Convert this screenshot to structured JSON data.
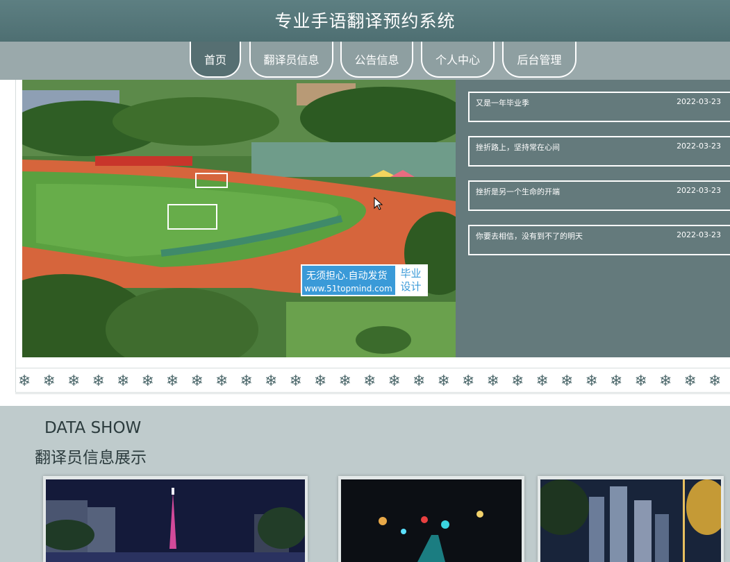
{
  "header": {
    "title": "专业手语翻译预约系统"
  },
  "nav": [
    {
      "label": "首页",
      "active": true
    },
    {
      "label": "翻译员信息"
    },
    {
      "label": "公告信息"
    },
    {
      "label": "个人中心"
    },
    {
      "label": "后台管理"
    }
  ],
  "news": [
    {
      "title": "又是一年毕业季",
      "date": "2022-03-23"
    },
    {
      "title": "挫折路上，坚持常在心间",
      "date": "2022-03-23"
    },
    {
      "title": "挫折是另一个生命的开端",
      "date": "2022-03-23"
    },
    {
      "title": "你要去相信，没有到不了的明天",
      "date": "2022-03-23"
    }
  ],
  "watermark": {
    "line1": "无须担心.自动发货",
    "line2": "www.51topmind.com",
    "right_top": "毕业",
    "right_bottom": "设计"
  },
  "decor": {
    "snowflake_glyph": "❄",
    "snowflake_count": 29
  },
  "data_show": {
    "title_en": "DATA SHOW",
    "title_zh": "翻译员信息展示"
  },
  "cards": [
    {
      "image": "night-city-tower-photo"
    },
    {
      "image": "night-street-bokeh-photo"
    },
    {
      "image": "night-skyline-palms-photo"
    }
  ],
  "colors": {
    "header": "#527477",
    "nav_band": "#9aa9ab",
    "news_panel": "#647a7c",
    "section_bg": "#bfcbcc"
  }
}
